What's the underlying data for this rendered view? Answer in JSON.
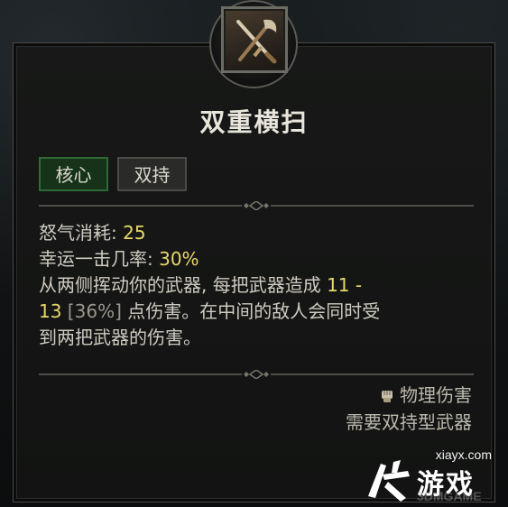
{
  "skill": {
    "title": "双重横扫",
    "icon": "crossed-sword-axe-icon",
    "tags": [
      "核心",
      "双持"
    ]
  },
  "stats": {
    "fury_label": "怒气消耗: ",
    "fury_value": "25",
    "crit_label": "幸运一击几率: ",
    "crit_value": "30%",
    "desc_line1_prefix": "从两侧挥动你的武器, 每把武器造成 ",
    "desc_line1_value": "11 -",
    "desc_line2_value": "13",
    "desc_line2_bracket": " [36%]",
    "desc_line2_suffix": " 点伤害。在中间的敌人会同时受",
    "desc_line3": "到两把武器的伤害。"
  },
  "footer": {
    "damage_type_icon": "fist-icon",
    "damage_type": "物理伤害",
    "requirement": "需要双持型武器"
  },
  "watermark": {
    "site": "xiayx.com",
    "brand": "游戏",
    "sub": "3DMGAME"
  },
  "colors": {
    "highlight": "#e8d86a",
    "core_tag_bg": "#16331a",
    "core_tag_border": "#2e6a33",
    "panel_border": "#4a4b46"
  }
}
